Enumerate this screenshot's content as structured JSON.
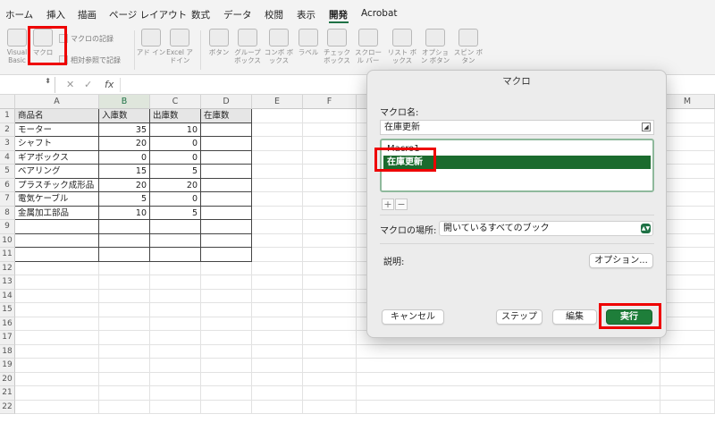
{
  "ribbon_tabs": [
    "ホーム",
    "挿入",
    "描画",
    "ページ レイアウト",
    "数式",
    "データ",
    "校閲",
    "表示",
    "開発",
    "Acrobat"
  ],
  "active_tab": "開発",
  "ribbon": {
    "visual_basic": "Visual Basic",
    "macro": "マクロ",
    "record_macro": "マクロの記録",
    "relative_ref": "相対参照で記録",
    "addins": "アド イン",
    "excel_addins": "Excel アドイン",
    "controls": [
      "ボタン",
      "グループ ボックス",
      "コンボ ボックス",
      "ラベル",
      "チェック ボックス",
      "スクロール バー",
      "リスト ボックス",
      "オプション ボタン",
      "スピン ボタン"
    ]
  },
  "formula_bar": {
    "fx": "fx",
    "cancel": "✕",
    "confirm": "✓"
  },
  "sheet": {
    "columns": [
      "A",
      "B",
      "C",
      "D",
      "E",
      "F",
      "M"
    ],
    "rows": [
      [
        "商品名",
        "入庫数",
        "出庫数",
        "在庫数"
      ],
      [
        "モーター",
        "35",
        "10",
        ""
      ],
      [
        "シャフト",
        "20",
        "0",
        ""
      ],
      [
        "ギアボックス",
        "0",
        "0",
        ""
      ],
      [
        "ベアリング",
        "15",
        "5",
        ""
      ],
      [
        "プラスチック成形品",
        "20",
        "20",
        ""
      ],
      [
        "電気ケーブル",
        "5",
        "0",
        ""
      ],
      [
        "金属加工部品",
        "10",
        "5",
        ""
      ]
    ],
    "row_numbers": [
      "1",
      "2",
      "3",
      "4",
      "5",
      "6",
      "7",
      "8",
      "9",
      "10",
      "11",
      "12",
      "13",
      "14",
      "15",
      "16",
      "17",
      "18",
      "19",
      "20",
      "21",
      "22"
    ]
  },
  "dialog": {
    "title": "マクロ",
    "name_label": "マクロ名:",
    "name_value": "在庫更新",
    "macros": [
      "Macro1",
      "在庫更新"
    ],
    "selected_macro": "在庫更新",
    "add": "+",
    "remove": "−",
    "location_label": "マクロの場所:",
    "location_value": "開いているすべてのブック",
    "description_label": "説明:",
    "options_button": "オプション...",
    "cancel_button": "キャンセル",
    "step_button": "ステップ",
    "edit_button": "編集",
    "run_button": "実行"
  },
  "colors": {
    "accent": "#1e7145",
    "highlight": "#e00000"
  }
}
